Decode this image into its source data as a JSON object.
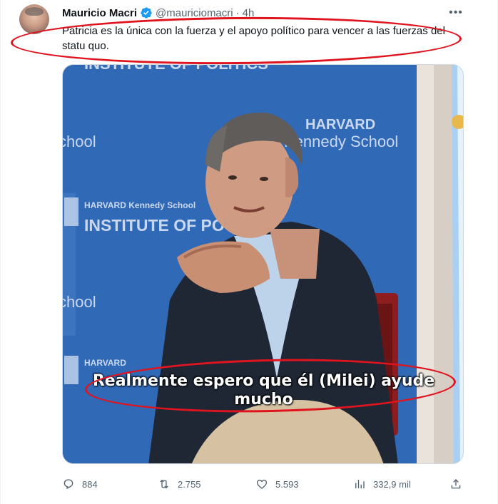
{
  "tweet": {
    "author_name": "Mauricio Macri",
    "handle": "@mauriciomacri",
    "dot": "·",
    "time": "4h",
    "more": "•••",
    "text": "Patricia es la única con la fuerza y el apoyo político para vencer a las fuerzas del statu quo."
  },
  "video": {
    "caption_line1": "Realmente espero que él (Milei) ayude",
    "caption_line2": "mucho",
    "backdrop_texts": {
      "top": "INSTITUTE OF POLITICS",
      "harvard": "HARVARD",
      "kennedy": "Kennedy School",
      "school_left": "chool",
      "banner_small": "HARVARD Kennedy School",
      "banner_large": "INSTITUTE OF PO",
      "school_left2": "chool",
      "harvard2": "HARVARD"
    }
  },
  "actions": {
    "replies": "884",
    "reposts": "2.755",
    "likes": "5.593",
    "views": "332,9 mil"
  },
  "colors": {
    "annotation": "#e0141f",
    "backdrop_blue": "#2a63b0",
    "verified": "#1d9bf0"
  }
}
